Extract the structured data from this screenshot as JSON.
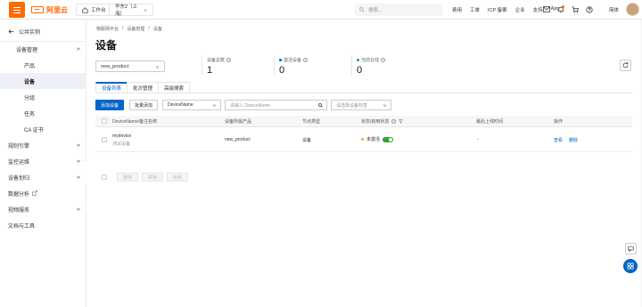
{
  "topbar": {
    "logo_text": "阿里云",
    "workspace_label": "工作台",
    "region_label": "华东2（上海）",
    "search_placeholder": "搜索...",
    "nav": [
      "费用",
      "工单",
      "ICP 备案",
      "企业",
      "支持",
      "App"
    ],
    "user_name": "简体"
  },
  "sidebar": {
    "back_label": "公共实例",
    "groups": [
      {
        "label": "设备管理",
        "expanded": true
      },
      {
        "label": "规则引擎"
      },
      {
        "label": "监控运维"
      },
      {
        "label": "设备划归"
      },
      {
        "label": "数据分析"
      },
      {
        "label": "视频服务"
      },
      {
        "label": "文档与工具"
      }
    ],
    "sub_items": [
      "产品",
      "设备",
      "分组",
      "任务",
      "CA 证书"
    ],
    "active_sub": "设备"
  },
  "breadcrumb": [
    "物联网平台",
    "/",
    "设备管理",
    "/",
    "设备"
  ],
  "page_title": "设备",
  "product_select": "new_product",
  "stats": [
    {
      "label": "设备总数",
      "value": "1",
      "dot_color": ""
    },
    {
      "label": "激活设备",
      "value": "0",
      "dot_color": "#0064c8"
    },
    {
      "label": "当前在线",
      "value": "0",
      "dot_color": "#2aa52e"
    }
  ],
  "tabs": [
    "设备列表",
    "批次管理",
    "高级搜索"
  ],
  "toolbar": {
    "add_device": "添加设备",
    "batch_add": "批量添加",
    "filter_field": "DeviceName",
    "filter_placeholder": "请输入 DeviceName",
    "tag_placeholder": "请选择设备标签"
  },
  "table": {
    "headers": [
      "DeviceName/备注名称",
      "设备所属产品",
      "节点类型",
      "状态/启用状态",
      "最后上线时间",
      "操作"
    ],
    "rows": [
      {
        "name": "mydevice",
        "note": "测试设备",
        "product": "new_product",
        "node_type": "设备",
        "status": "未激活",
        "last_online": "-",
        "actions": [
          "查看",
          "删除"
        ]
      }
    ]
  },
  "footer_actions": [
    "删除",
    "禁用",
    "启用"
  ],
  "colors": {
    "brand_orange": "#ff6a00",
    "primary_blue": "#0064c8",
    "status_inactive": "#f5a623",
    "toggle_on": "#2aa52e"
  }
}
